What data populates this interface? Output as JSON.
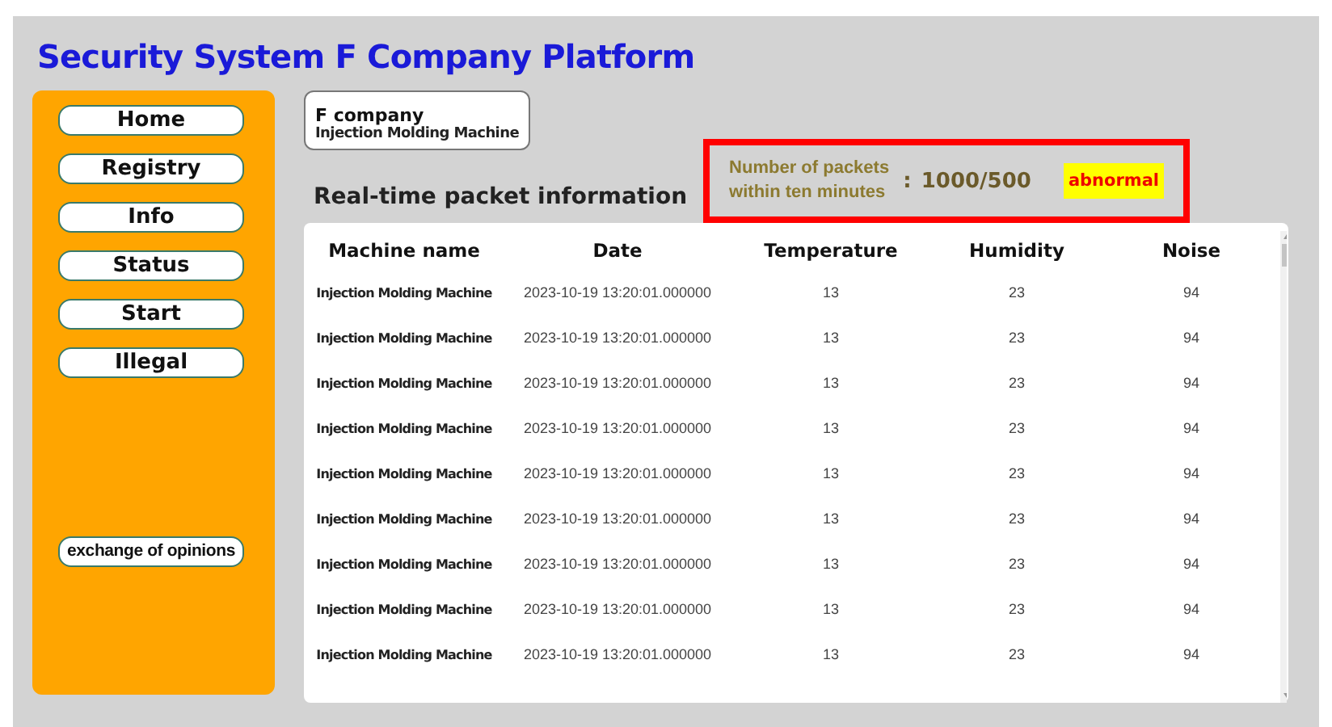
{
  "title": "Security System F Company Platform",
  "sidebar": {
    "items": [
      {
        "label": "Home"
      },
      {
        "label": "Registry"
      },
      {
        "label": "Info"
      },
      {
        "label": "Status"
      },
      {
        "label": "Start"
      },
      {
        "label": "Illegal"
      }
    ],
    "extra": {
      "label": "exchange of opinions"
    }
  },
  "selector": {
    "line1": "F company",
    "line2": "Injection Molding Machine"
  },
  "section_title": "Real-time packet information",
  "packet_alert": {
    "label": "Number of packets within ten minutes",
    "separator": ":",
    "value": "1000/500",
    "status": "abnormal",
    "abnormal": true
  },
  "table": {
    "columns": [
      "Machine name",
      "Date",
      "Temperature",
      "Humidity",
      "Noise"
    ],
    "rows": [
      [
        "Injection Molding Machine",
        "2023-10-19 13:20:01.000000",
        "13",
        "23",
        "94"
      ],
      [
        "Injection Molding Machine",
        "2023-10-19 13:20:01.000000",
        "13",
        "23",
        "94"
      ],
      [
        "Injection Molding Machine",
        "2023-10-19 13:20:01.000000",
        "13",
        "23",
        "94"
      ],
      [
        "Injection Molding Machine",
        "2023-10-19 13:20:01.000000",
        "13",
        "23",
        "94"
      ],
      [
        "Injection Molding Machine",
        "2023-10-19 13:20:01.000000",
        "13",
        "23",
        "94"
      ],
      [
        "Injection Molding Machine",
        "2023-10-19 13:20:01.000000",
        "13",
        "23",
        "94"
      ],
      [
        "Injection Molding Machine",
        "2023-10-19 13:20:01.000000",
        "13",
        "23",
        "94"
      ],
      [
        "Injection Molding Machine",
        "2023-10-19 13:20:01.000000",
        "13",
        "23",
        "94"
      ],
      [
        "Injection Molding Machine",
        "2023-10-19 13:20:01.000000",
        "13",
        "23",
        "94"
      ]
    ]
  }
}
